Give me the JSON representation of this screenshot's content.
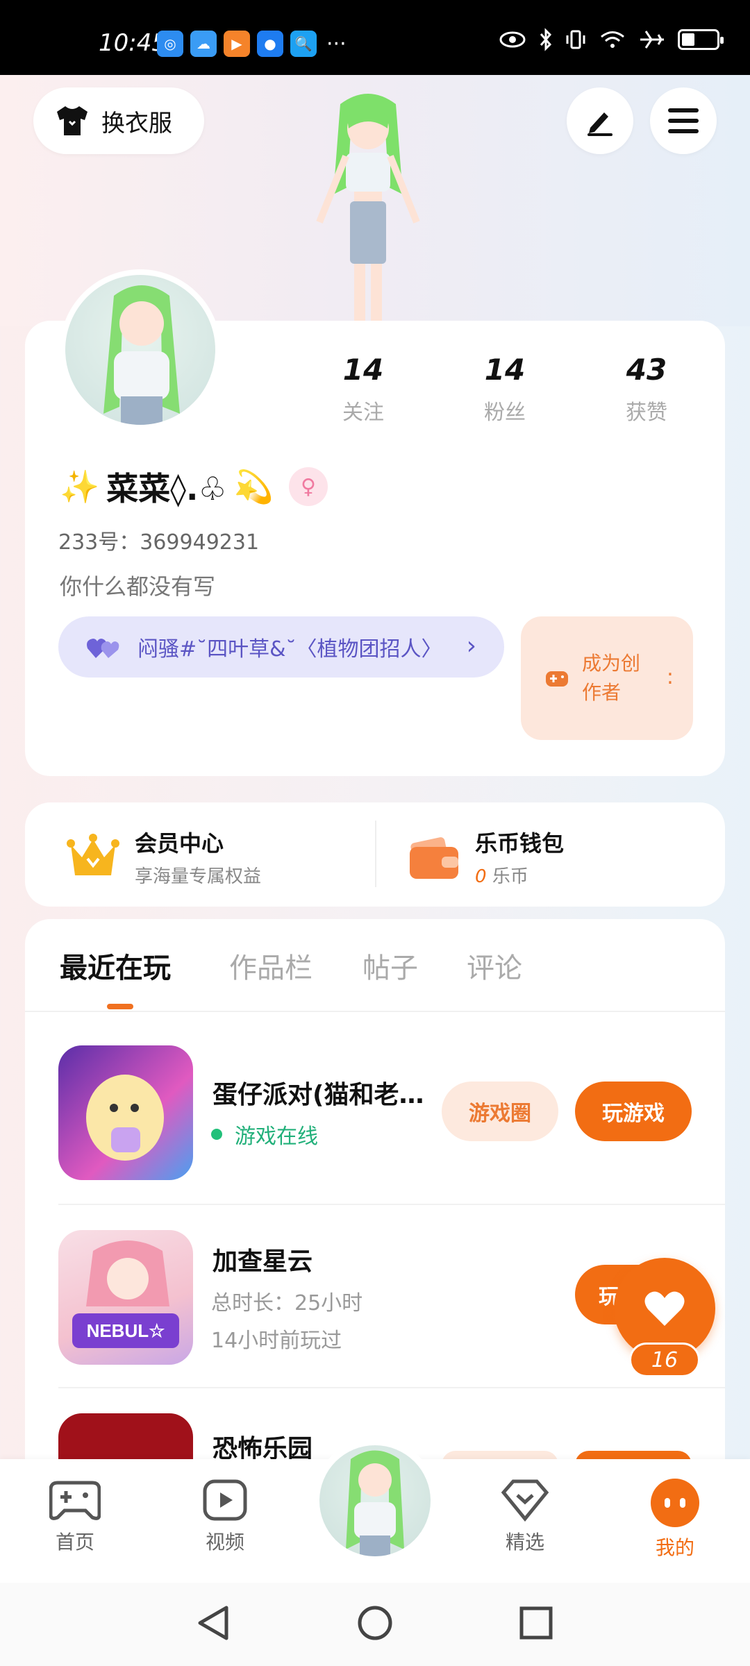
{
  "status_bar": {
    "time": "10:45",
    "more": "···"
  },
  "header": {
    "outfit_label": "换衣服"
  },
  "profile": {
    "stats": [
      {
        "num": "14",
        "label": "关注"
      },
      {
        "num": "14",
        "label": "粉丝"
      },
      {
        "num": "43",
        "label": "获赞"
      }
    ],
    "nickname": "菜菜◊.♧",
    "uid": "233号：369949231",
    "bio": "你什么都没有写",
    "group": "闷骚#˘四叶草&˘〈植物团招人〉",
    "creator": "成为创作者"
  },
  "vip": {
    "title": "会员中心",
    "sub": "享海量专属权益"
  },
  "wallet": {
    "title": "乐币钱包",
    "amount": "0",
    "unit": "乐币"
  },
  "tabs": [
    "最近在玩",
    "作品栏",
    "帖子",
    "评论"
  ],
  "games": [
    {
      "name": "蛋仔派对(猫和老鼠联动)",
      "status": "游戏在线",
      "btn_circle": "游戏圈",
      "btn_play": "玩游戏"
    },
    {
      "name": "加查星云",
      "duration": "总时长：25小时",
      "last": "14小时前玩过",
      "btn_play": "玩"
    },
    {
      "name": "恐怖乐园"
    }
  ],
  "like": {
    "count": "16"
  },
  "bottom_nav": [
    {
      "label": "首页"
    },
    {
      "label": "视频"
    },
    {
      "label": "精选"
    },
    {
      "label": "我的"
    }
  ],
  "colors": {
    "accent": "#f26d13",
    "group": "#5b55c4",
    "online": "#22b07a"
  }
}
